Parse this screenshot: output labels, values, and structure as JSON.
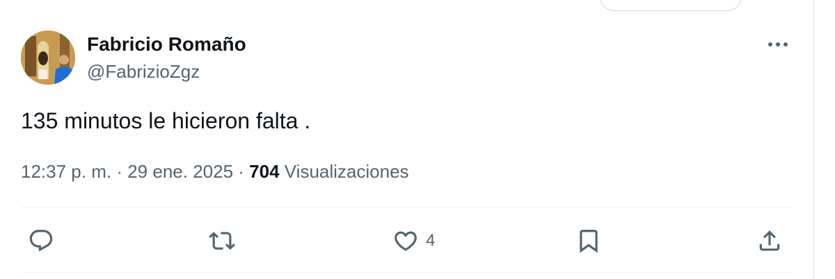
{
  "tweet": {
    "author": {
      "display_name": "Fabricio Romaño",
      "handle": "@FabrizioZgz",
      "avatar_icon": "avatar-photo"
    },
    "text": "135 minutos le hicieron falta .",
    "meta": {
      "time": "12:37 p. m.",
      "separator": "·",
      "date": "29 ene. 2025",
      "views_count": "704",
      "views_label": "Visualizaciones"
    },
    "actions": {
      "reply_icon": "reply-icon",
      "retweet_icon": "retweet-icon",
      "like_icon": "heart-icon",
      "like_count": "4",
      "bookmark_icon": "bookmark-icon",
      "share_icon": "share-icon",
      "more_icon": "more-icon"
    }
  },
  "colors": {
    "primary_text": "#0f1419",
    "secondary_text": "#536471",
    "divider": "#eff3f4"
  }
}
